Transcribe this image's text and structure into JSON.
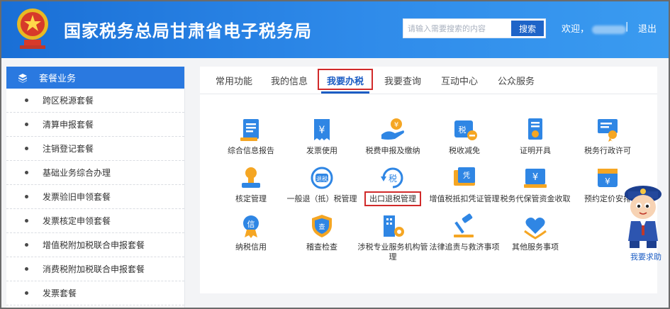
{
  "header": {
    "title": "国家税务总局甘肃省电子税务局",
    "search_placeholder": "请输入需要搜索的内容",
    "search_button": "搜索",
    "welcome": "欢迎，",
    "separator": "|",
    "logout": "退出"
  },
  "sidebar": {
    "header": "套餐业务",
    "items": [
      "跨区税源套餐",
      "清算申报套餐",
      "注销登记套餐",
      "基础业务综合办理",
      "发票验旧申领套餐",
      "发票核定申领套餐",
      "增值税附加税联合申报套餐",
      "消费税附加税联合申报套餐",
      "发票套餐"
    ]
  },
  "tabs": [
    "常用功能",
    "我的信息",
    "我要办税",
    "我要查询",
    "互动中心",
    "公众服务"
  ],
  "active_tab": "我要办税",
  "grid": [
    {
      "label": "综合信息报告",
      "icon": "report-icon"
    },
    {
      "label": "发票使用",
      "icon": "invoice-icon"
    },
    {
      "label": "税费申报及缴纳",
      "icon": "tax-payment-icon"
    },
    {
      "label": "税收减免",
      "icon": "tax-reduction-icon"
    },
    {
      "label": "证明开具",
      "icon": "certificate-icon"
    },
    {
      "label": "税务行政许可",
      "icon": "license-icon"
    },
    {
      "label": "核定管理",
      "icon": "stamp-icon"
    },
    {
      "label": "一般退（抵）税管理",
      "icon": "refund-icon"
    },
    {
      "label": "出口退税管理",
      "icon": "export-refund-icon"
    },
    {
      "label": "增值税抵扣凭证管理",
      "icon": "voucher-icon"
    },
    {
      "label": "税务代保管资金收取",
      "icon": "fund-custody-icon"
    },
    {
      "label": "预约定价安排",
      "icon": "pricing-calendar-icon"
    },
    {
      "label": "纳税信用",
      "icon": "credit-icon"
    },
    {
      "label": "稽查检查",
      "icon": "inspection-shield-icon"
    },
    {
      "label": "涉税专业服务机构管理",
      "icon": "agency-building-icon"
    },
    {
      "label": "法律追责与救济事项",
      "icon": "gavel-icon"
    },
    {
      "label": "其他服务事项",
      "icon": "heart-hand-icon"
    }
  ],
  "help": {
    "label": "我要求助"
  },
  "colors": {
    "primary": "#2a79e0",
    "highlight": "#d12a2a",
    "icon_blue": "#2f86e4",
    "icon_orange": "#f5a623"
  }
}
